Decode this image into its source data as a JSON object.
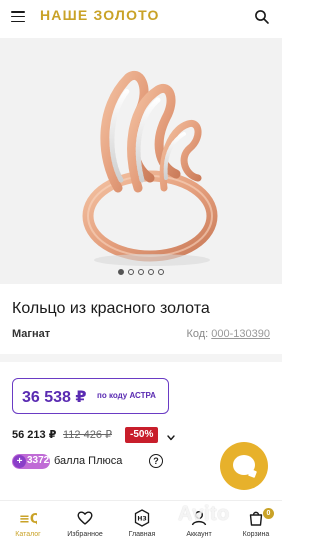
{
  "header": {
    "logo": "НАШЕ ЗОЛОТО",
    "logo_color": "#c9a227",
    "menu_icon": "burger-menu-icon",
    "search_icon": "search-icon"
  },
  "gallery": {
    "image": "rose gold ring with white gold diamond-cut accents",
    "dot_count": 5,
    "active_dot": 1
  },
  "product": {
    "title": "Кольцо из красного золота",
    "brand": "Магнат",
    "code_label": "Код:",
    "code_value": "000-130390"
  },
  "promo": {
    "price": "36 538 ₽",
    "note": "по коду АСТРА",
    "accent": "#5a2bb2"
  },
  "pricing": {
    "price": "56 213 ₽",
    "old_price": "112 426 ₽",
    "discount": "-50%",
    "discount_color": "#c81e2b",
    "expand_icon": "chevron-down-icon"
  },
  "bonus": {
    "plus_symbol": "+",
    "amount": "3372",
    "label": "балла Плюса",
    "help": "?"
  },
  "chat": {
    "icon": "chat-bubble-icon",
    "color": "#e7b12b"
  },
  "tabbar": {
    "tabs": [
      {
        "label": "Каталог",
        "icon": "catalog-icon",
        "active": true
      },
      {
        "label": "Избранное",
        "icon": "heart-icon",
        "active": false
      },
      {
        "label": "Главная",
        "icon": "home-logo-icon",
        "active": false
      },
      {
        "label": "Аккаунт",
        "icon": "account-icon",
        "active": false
      },
      {
        "label": "Корзина",
        "icon": "cart-icon",
        "active": false
      }
    ],
    "home_logo_text": "НЗ",
    "cart_count": "0"
  },
  "watermark": "Avito"
}
